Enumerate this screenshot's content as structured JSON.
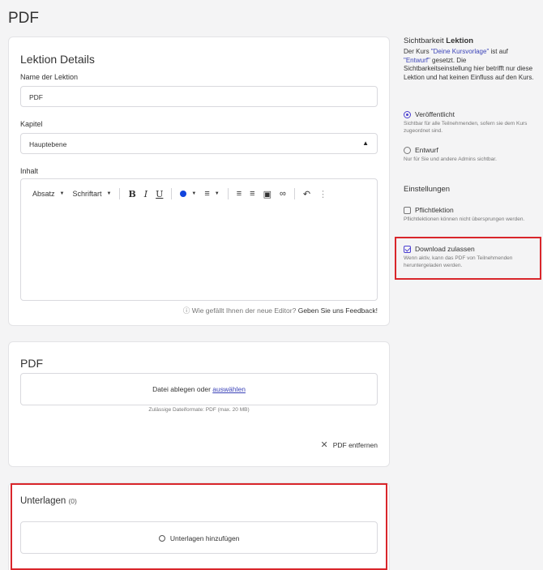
{
  "page": {
    "title": "PDF"
  },
  "details": {
    "title": "Lektion Details",
    "name_label": "Name der Lektion",
    "name_value": "PDF",
    "chapter_label": "Kapitel",
    "chapter_value": "Hauptebene",
    "content_label": "Inhalt",
    "toolbar": {
      "paragraph": "Absatz",
      "font": "Schriftart"
    },
    "feedback_text": "Wie gefällt Ihnen der neue Editor?",
    "feedback_link": "Geben Sie uns Feedback!"
  },
  "pdf": {
    "title": "PDF",
    "drop_text": "Datei ablegen oder",
    "drop_link": "auswählen",
    "formats_hint": "Zulässige Dateiformate: PDF (max. 20 MB)",
    "remove_label": "PDF entfernen"
  },
  "materials": {
    "title": "Unterlagen",
    "count": "(0)",
    "add_label": "Unterlagen hinzufügen"
  },
  "sidebar": {
    "visibility_title_prefix": "Sichtbarkeit",
    "visibility_title_bold": "Lektion",
    "visibility_text_1": "Der Kurs",
    "course_name": "\"Deine Kursvorlage\"",
    "visibility_text_2": "ist auf",
    "status_draft_quote": "\"Entwurf\"",
    "visibility_text_3": "gesetzt. Die Sichtbarkeitseinstellung hier betrifft nur diese Lektion und hat keinen Einfluss auf den Kurs.",
    "published_label": "Veröffentlicht",
    "published_desc": "Sichtbar für alle Teilnehmenden, sofern sie dem Kurs zugeordnet sind.",
    "draft_label": "Entwurf",
    "draft_desc": "Nur für Sie und andere Admins sichtbar.",
    "settings_title": "Einstellungen",
    "required_label": "Pflichtlektion",
    "required_desc": "Pflichtlektionen können nicht übersprungen werden.",
    "download_label": "Download zulassen",
    "download_desc": "Wenn aktiv, kann das PDF von Teilnehmenden heruntergeladen werden."
  },
  "colors": {
    "accent": "#4b3fd1",
    "link": "#3b43b8",
    "highlight": "#d9262b"
  }
}
